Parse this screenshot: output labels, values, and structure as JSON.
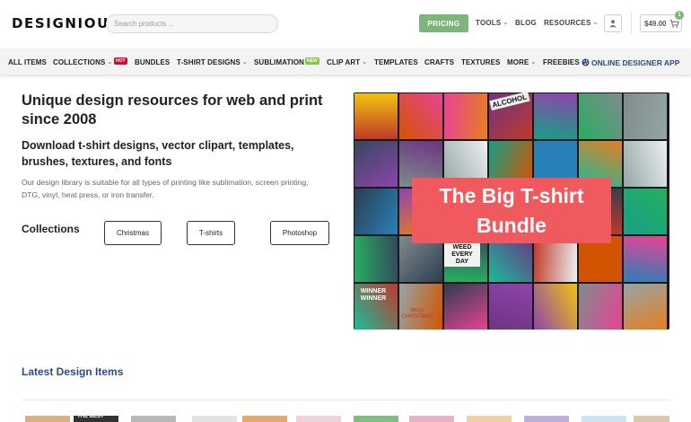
{
  "header": {
    "logo_text": "DESIGNIOUS",
    "search_placeholder": "Search products ...",
    "pricing_label": "PRICING",
    "nav": [
      {
        "label": "TOOLS",
        "dropdown": true
      },
      {
        "label": "BLOG",
        "dropdown": false
      },
      {
        "label": "RESOURCES",
        "dropdown": true
      }
    ],
    "cart_total": "$49.00",
    "cart_count": "1",
    "icons": {
      "user": "user-icon",
      "cart": "cart-icon"
    }
  },
  "categories": {
    "items": [
      {
        "label": "ALL ITEMS"
      },
      {
        "label": "COLLECTIONS",
        "dropdown": true,
        "badge": "HOT"
      },
      {
        "label": "BUNDLES"
      },
      {
        "label": "T-SHIRT DESIGNS",
        "dropdown": true
      },
      {
        "label": "SUBLIMATION",
        "badge": "NEW"
      },
      {
        "label": "CLIP ART",
        "dropdown": true
      },
      {
        "label": "TEMPLATES"
      },
      {
        "label": "CRAFTS"
      },
      {
        "label": "TEXTURES"
      },
      {
        "label": "MORE",
        "dropdown": true
      },
      {
        "label": "FREEBIES"
      }
    ],
    "online_app_label": "ONLINE DESIGNER APP",
    "online_app_icon": "palette-icon"
  },
  "hero": {
    "title": "Unique design resources for web and print since 2008",
    "subtitle": "Download t-shirt designs, vector clipart, templates, brushes, textures, and fonts",
    "description": "Our design library is suitable for all types of printing like sublimation, screen printing, DTG, vinyl, heat press, or iron transfer.",
    "collections_label": "Collections",
    "collection_buttons": [
      "Christmas",
      "T-shirts",
      "Photoshop"
    ]
  },
  "banner": {
    "label": "The Big T-shirt Bundle",
    "tile_texts": [
      "ALCOHOL",
      "WEED EVERY DAY",
      "WINNER WINNER",
      "Merry CHRISTMAS",
      "THE BEST"
    ]
  },
  "latest": {
    "title": "Latest Design Items"
  },
  "colors": {
    "accent_green": "#7db678",
    "brand_blue": "#2d4a85",
    "banner_red": "#f05a5e",
    "hot_badge": "#c8102e",
    "new_badge": "#8bc34a"
  }
}
